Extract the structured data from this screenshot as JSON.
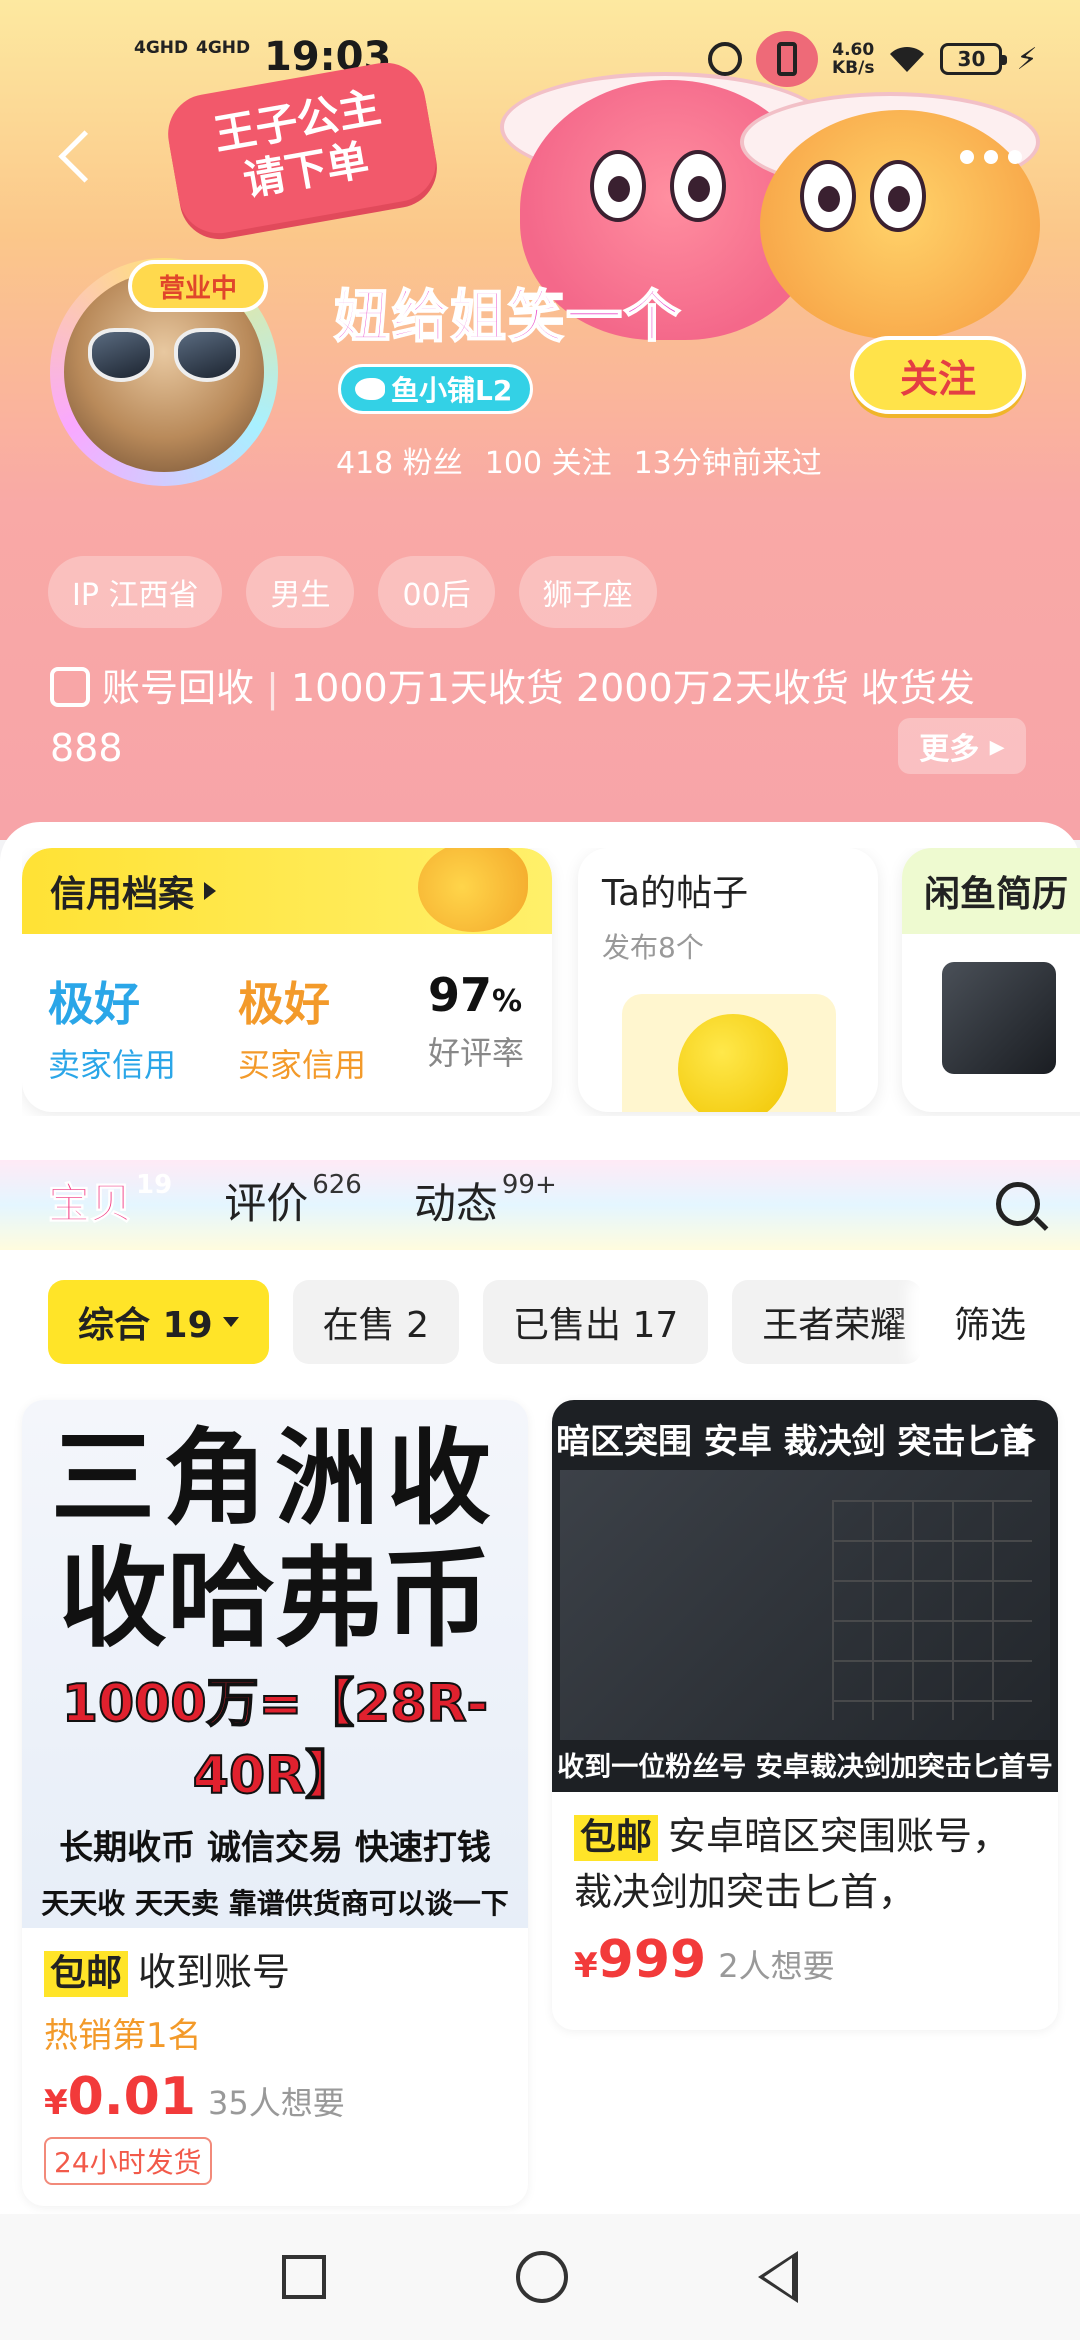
{
  "status_bar": {
    "time": "19:03",
    "net1": "4GHD",
    "net2": "4GHD",
    "speed_value": "4.60",
    "speed_unit": "KB/s",
    "battery": "30"
  },
  "header": {
    "banner_line1": "王子公主",
    "banner_line2": "请下单",
    "status_badge": "营业中",
    "shop_name": "妞给姐笑一个",
    "level_badge": "鱼小铺L2",
    "follow_label": "关注",
    "stats": {
      "fans": "418 粉丝",
      "following": "100 关注",
      "last_seen": "13分钟前来过"
    },
    "tags": [
      "IP 江西省",
      "男生",
      "00后",
      "狮子座"
    ],
    "intro_label": "账号回收",
    "intro_text": "1000万1天收货 2000万2天收货 收货发888",
    "more_label": "更多"
  },
  "cards": {
    "credit": {
      "title": "信用档案",
      "seller_value": "极好",
      "seller_label": "卖家信用",
      "buyer_value": "极好",
      "buyer_label": "买家信用",
      "rate_value": "97",
      "rate_unit": "%",
      "rate_label": "好评率"
    },
    "posts": {
      "title": "Ta的帖子",
      "subtitle": "发布8个"
    },
    "resume": {
      "title": "闲鱼简历"
    }
  },
  "tabs": [
    {
      "label": "宝贝",
      "count": "19"
    },
    {
      "label": "评价",
      "count": "626"
    },
    {
      "label": "动态",
      "count": "99+"
    }
  ],
  "filters": {
    "chips": [
      "综合 19",
      "在售 2",
      "已售出 17",
      "王者荣耀"
    ],
    "filter_label": "筛选"
  },
  "products": [
    {
      "image_text": [
        "三角洲收",
        "收哈弗币",
        "1000万=【28R-40R】",
        "长期收币  诚信交易  快速打钱",
        "天天收  天天卖  靠谱供货商可以谈一下"
      ],
      "badge": "包邮",
      "title": "收到账号",
      "hot": "热销第1名",
      "currency": "¥",
      "price": "0.01",
      "want": "35人想要",
      "service": "24小时发货"
    },
    {
      "image_top": "暗区突围 安卓 裁决剑 突击匕首",
      "image_caption": "收到一位粉丝号 安卓裁决剑加突击匕首号",
      "badge": "包邮",
      "title": "安卓暗区突围账号，裁决剑加突击匕首，",
      "currency": "¥",
      "price": "999",
      "want": "2人想要"
    }
  ]
}
